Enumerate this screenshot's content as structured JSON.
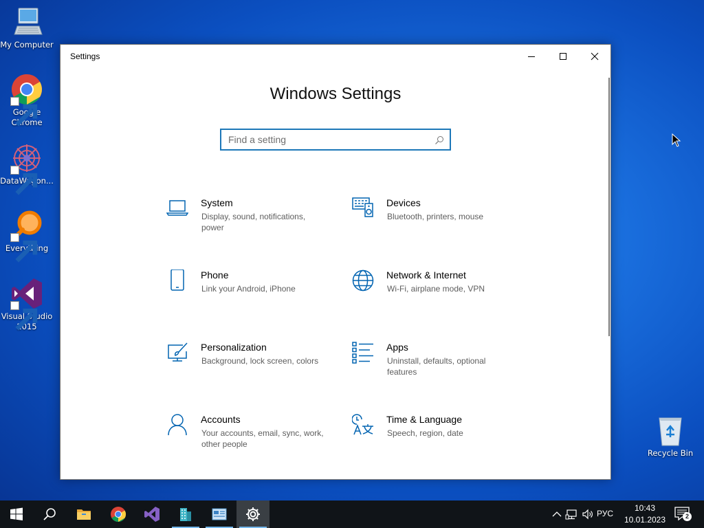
{
  "desktop": {
    "icons": [
      {
        "label": "My Computer"
      },
      {
        "label": "Google Chrome"
      },
      {
        "label": "DataWagon..."
      },
      {
        "label": "Everything"
      },
      {
        "label": "Visual Studio 2015"
      },
      {
        "label": "Recycle Bin"
      }
    ]
  },
  "window": {
    "title": "Settings",
    "heading": "Windows Settings",
    "search_placeholder": "Find a setting",
    "tiles": [
      {
        "title": "System",
        "desc": "Display, sound, notifications, power",
        "icon": "laptop-icon"
      },
      {
        "title": "Devices",
        "desc": "Bluetooth, printers, mouse",
        "icon": "devices-icon"
      },
      {
        "title": "Phone",
        "desc": "Link your Android, iPhone",
        "icon": "phone-icon"
      },
      {
        "title": "Network & Internet",
        "desc": "Wi-Fi, airplane mode, VPN",
        "icon": "globe-icon"
      },
      {
        "title": "Personalization",
        "desc": "Background, lock screen, colors",
        "icon": "paintbrush-icon"
      },
      {
        "title": "Apps",
        "desc": "Uninstall, defaults, optional features",
        "icon": "apps-list-icon"
      },
      {
        "title": "Accounts",
        "desc": "Your accounts, email, sync, work, other people",
        "icon": "person-icon"
      },
      {
        "title": "Time & Language",
        "desc": "Speech, region, date",
        "icon": "time-language-icon"
      }
    ]
  },
  "taskbar": {
    "language": "РУС",
    "time": "10:43",
    "date": "10.01.2023",
    "notification_count": "2"
  },
  "colors": {
    "accent": "#1c77b8",
    "icon_blue": "#0063b1",
    "taskbar": "#101418"
  }
}
